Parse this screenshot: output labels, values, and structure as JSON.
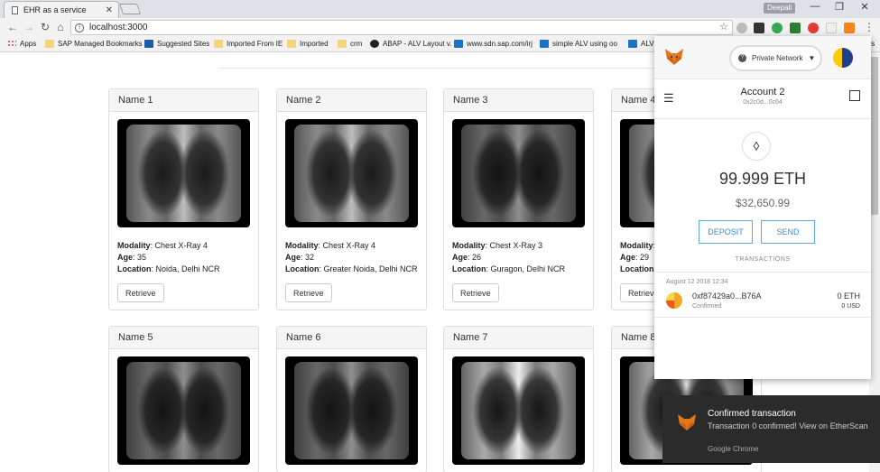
{
  "browser": {
    "tab_title": "EHR as a service",
    "tab_close": "✕",
    "profile_name": "Deepali",
    "url": "localhost:3000",
    "window_controls": {
      "minimize": "—",
      "restore": "❐",
      "close": "✕"
    }
  },
  "bookmarks": [
    {
      "label": "Apps",
      "icon": "apps-grid-icon"
    },
    {
      "label": "SAP Managed Bookmarks",
      "icon": "folder-icon"
    },
    {
      "label": "Suggested Sites",
      "icon": "bing-icon"
    },
    {
      "label": "Imported From IE",
      "icon": "folder-icon"
    },
    {
      "label": "Imported",
      "icon": "folder-icon"
    },
    {
      "label": "crm",
      "icon": "folder-icon"
    },
    {
      "label": "ABAP - ALV Layout v.",
      "icon": "web-icon"
    },
    {
      "label": "www.sdn.sap.com/irj",
      "icon": "sap-icon"
    },
    {
      "label": "simple ALV using oo",
      "icon": "sap-icon"
    },
    {
      "label": "ALV",
      "icon": "sap-icon"
    },
    {
      "label": "arks",
      "icon": ""
    }
  ],
  "cards": [
    {
      "name": "Name 1",
      "modality_label": "Modality",
      "modality": "Chest X-Ray 4",
      "age_label": "Age",
      "age": "35",
      "location_label": "Location",
      "location": "Noida, Delhi NCR",
      "button": "Retrieve"
    },
    {
      "name": "Name 2",
      "modality_label": "Modality",
      "modality": "Chest X-Ray 4",
      "age_label": "Age",
      "age": "32",
      "location_label": "Location",
      "location": "Greater Noida, Delhi NCR",
      "button": "Retrieve"
    },
    {
      "name": "Name 3",
      "modality_label": "Modality",
      "modality": "Chest X-Ray 3",
      "age_label": "Age",
      "age": "26",
      "location_label": "Location",
      "location": "Guragon, Delhi NCR",
      "button": "Retrieve"
    },
    {
      "name": "Name 4",
      "modality_label": "Modality",
      "modality": "",
      "age_label": "Age",
      "age": "29",
      "location_label": "Location",
      "location": "",
      "button": "Retrieve"
    },
    {
      "name": "Name 5"
    },
    {
      "name": "Name 6"
    },
    {
      "name": "Name 7"
    },
    {
      "name": "Name 8"
    }
  ],
  "metamask": {
    "network": "Private Network",
    "account_name": "Account 2",
    "account_address": "0x2c0d...0c64",
    "eth_symbol": "⬨",
    "balance_eth": "99.999 ETH",
    "balance_usd": "$32,650.99",
    "deposit_label": "DEPOSIT",
    "send_label": "SEND",
    "transactions_label": "TRANSACTIONS",
    "transaction": {
      "date": "August 12 2018 12:34",
      "hash": "0xf87429a0...B76A",
      "status": "Confirmed",
      "amount_eth": "0 ETH",
      "amount_usd": "0 USD"
    }
  },
  "notification": {
    "title": "Confirmed transaction",
    "message": "Transaction 0 confirmed! View on EtherScan",
    "source": "Google Chrome"
  }
}
